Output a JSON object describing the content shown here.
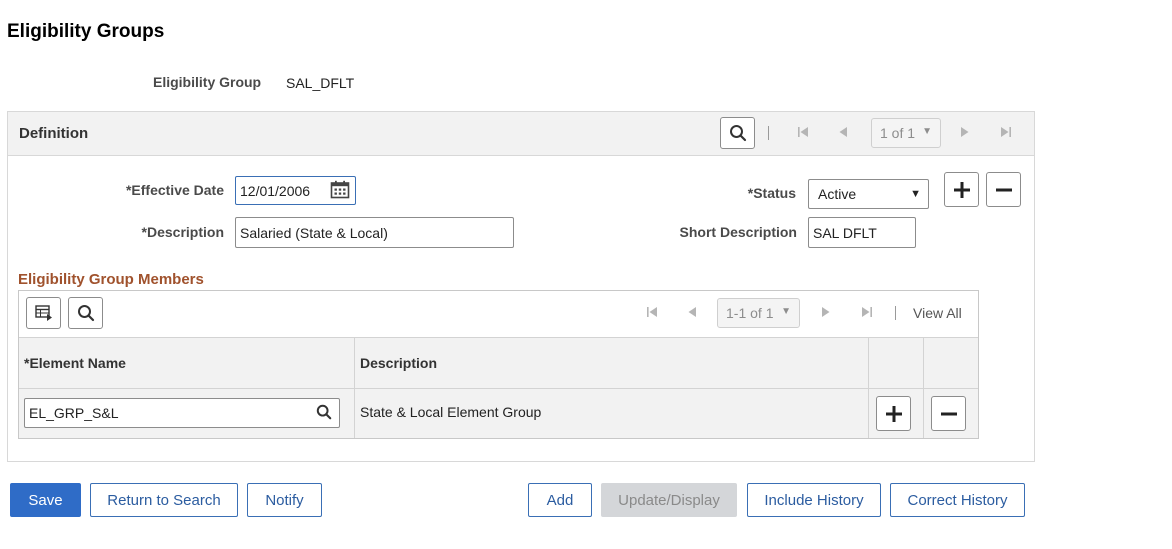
{
  "page": {
    "title": "Eligibility Groups"
  },
  "key": {
    "label": "Eligibility Group",
    "value": "SAL_DFLT"
  },
  "definition": {
    "title": "Definition",
    "pager": "1 of 1",
    "effective_date_label": "*Effective Date",
    "effective_date_value": "12/01/2006",
    "status_label": "*Status",
    "status_value": "Active",
    "description_label": "*Description",
    "description_value": "Salaried (State & Local)",
    "short_description_label": "Short Description",
    "short_description_value": "SAL DFLT"
  },
  "members": {
    "title": "Eligibility Group Members",
    "pager": "1-1 of 1",
    "view_all": "View All",
    "columns": [
      "*Element Name",
      "Description"
    ],
    "rows": [
      {
        "element_name": "EL_GRP_S&L",
        "description": "State & Local Element Group"
      }
    ]
  },
  "buttons": {
    "save": "Save",
    "return_to_search": "Return to Search",
    "notify": "Notify",
    "add": "Add",
    "update_display": "Update/Display",
    "include_history": "Include History",
    "correct_history": "Correct History"
  },
  "icons": {
    "search": "search-icon",
    "calendar": "calendar-icon",
    "add_row": "plus-icon",
    "delete_row": "minus-icon",
    "personalize": "grid-personalize-icon",
    "first": "first-page-icon",
    "prev": "previous-page-icon",
    "next": "next-page-icon",
    "last": "last-page-icon"
  },
  "colors": {
    "primary_button": "#2f6cc7",
    "link_blue": "#2b5ca0",
    "section_title": "#a0522d",
    "disabled_button": "#d4d6d9"
  }
}
